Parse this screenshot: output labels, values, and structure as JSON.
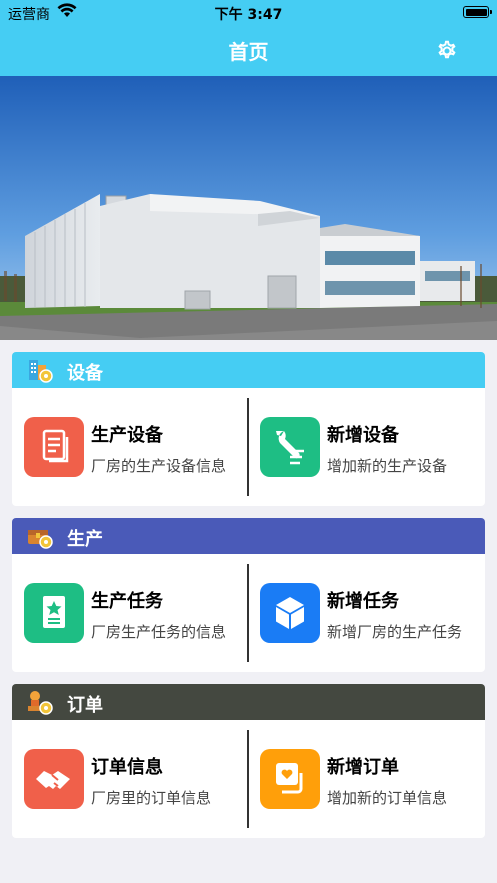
{
  "status_bar": {
    "carrier": "运营商",
    "time": "下午 3:47"
  },
  "nav": {
    "title": "首页"
  },
  "sections": [
    {
      "title": "设备",
      "color": "#45cdf3",
      "cards": [
        {
          "title": "生产设备",
          "subtitle": "厂房的生产设备信息",
          "icon": "document-icon",
          "color": "#f0604a"
        },
        {
          "title": "新增设备",
          "subtitle": "增加新的生产设备",
          "icon": "wrench-icon",
          "color": "#1ebe84"
        }
      ]
    },
    {
      "title": "生产",
      "color": "#4a5ab8",
      "cards": [
        {
          "title": "生产任务",
          "subtitle": "厂房生产任务的信息",
          "icon": "task-star-icon",
          "color": "#1ebe84"
        },
        {
          "title": "新增任务",
          "subtitle": "新增厂房的生产任务",
          "icon": "cube-icon",
          "color": "#1a7cf5"
        }
      ]
    },
    {
      "title": "订单",
      "color": "#444840",
      "cards": [
        {
          "title": "订单信息",
          "subtitle": "厂房里的订单信息",
          "icon": "handshake-icon",
          "color": "#f0604a"
        },
        {
          "title": "新增订单",
          "subtitle": "增加新的订单信息",
          "icon": "heart-box-icon",
          "color": "#ff9f0a"
        }
      ]
    }
  ]
}
